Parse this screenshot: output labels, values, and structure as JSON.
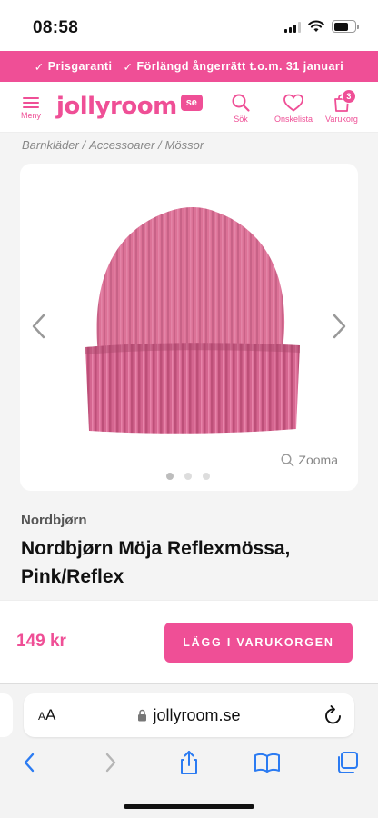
{
  "status_bar": {
    "time": "08:58"
  },
  "promo": {
    "items": [
      "Prisgaranti",
      "Förlängd ångerrätt t.o.m. 31 januari"
    ]
  },
  "header": {
    "menu_label": "Meny",
    "logo_text": "jollyroom",
    "logo_badge": "se",
    "search_label": "Sök",
    "wishlist_label": "Önskelista",
    "cart_label": "Varukorg",
    "cart_count": "3"
  },
  "breadcrumb": [
    "Barnkläder",
    "Accessoarer",
    "Mössor"
  ],
  "gallery": {
    "zoom_label": "Zooma",
    "image_count": 3,
    "active_index": 0
  },
  "product": {
    "brand": "Nordbjørn",
    "title": "Nordbjørn Möja Reflexmössa, Pink/Reflex",
    "price": "149 kr",
    "add_to_cart": "LÄGG I VARUKORGEN"
  },
  "browser": {
    "text_size_label": "AA",
    "url": "jollyroom.se"
  },
  "colors": {
    "accent": "#ef4f96",
    "product": "#d9678f"
  }
}
